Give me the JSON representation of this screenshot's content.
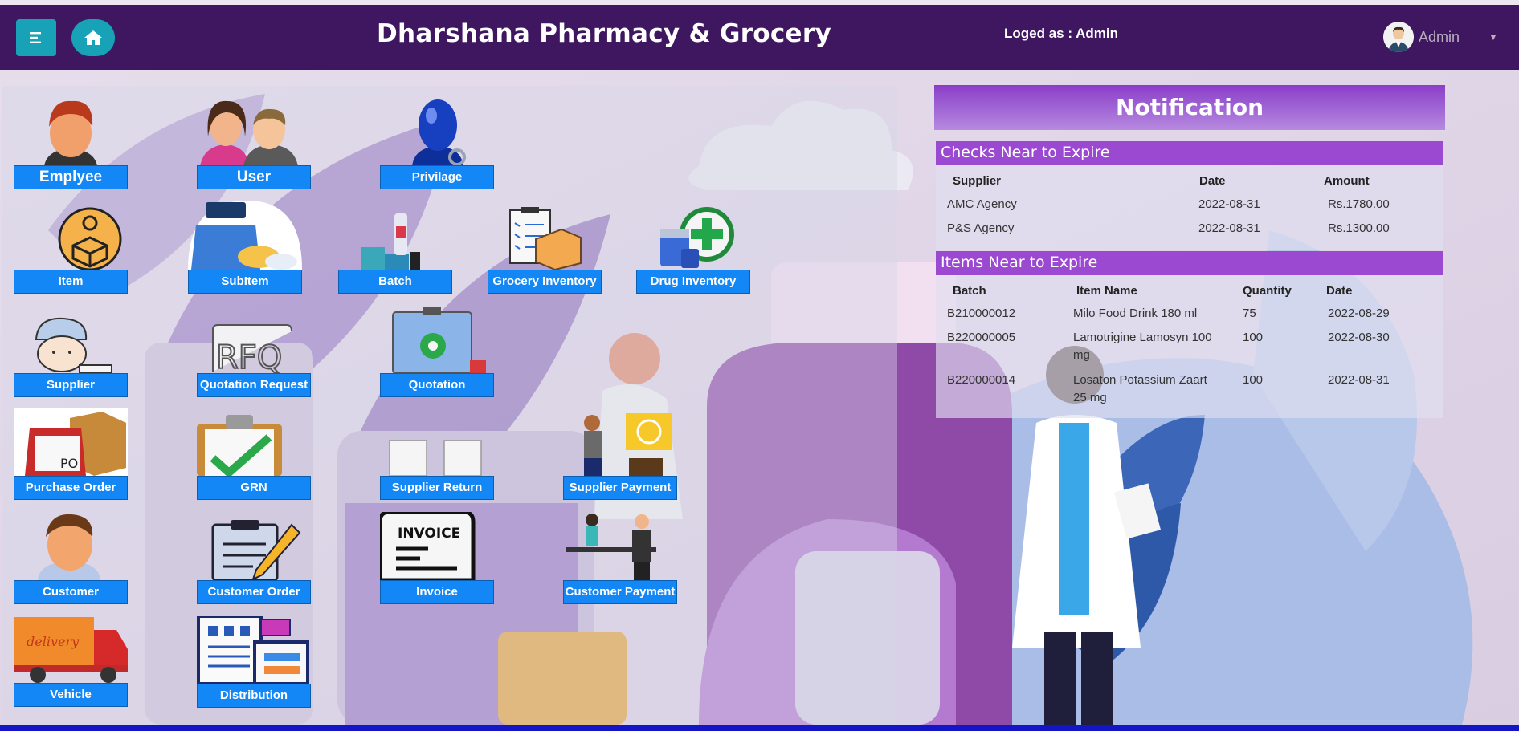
{
  "header": {
    "title": "Dharshana Pharmacy & Grocery",
    "logged_as": "Loged as : Admin",
    "user_name": "Admin",
    "color": "#3e1760",
    "button_color": "#17a2b8"
  },
  "tiles": {
    "employee": "Emplyee",
    "user": "User",
    "privilege": "Privilage",
    "item": "Item",
    "subitem": "SubItem",
    "batch": "Batch",
    "grocery_inventory": "Grocery Inventory",
    "drug_inventory": "Drug Inventory",
    "supplier": "Supplier",
    "quotation_request": "Quotation Request",
    "quotation": "Quotation",
    "purchase_order": "Purchase Order",
    "grn": "GRN",
    "supplier_return": "Supplier Return",
    "supplier_payment": "Supplier Payment",
    "customer": "Customer",
    "customer_order": "Customer Order",
    "invoice": "Invoice",
    "customer_payment": "Customer Payment",
    "vehicle": "Vehicle",
    "distribution": "Distribution"
  },
  "tile_color": "#1287f5",
  "icon_text": {
    "rfq": "RFQ",
    "po": "PO",
    "invoice": "INVOICE",
    "delivery": "delivery"
  },
  "notification": {
    "title": "Notification",
    "checks": {
      "heading": "Checks Near to Expire",
      "columns": [
        "Supplier",
        "Date",
        "Amount"
      ],
      "rows": [
        [
          "AMC Agency",
          "2022-08-31",
          "Rs.1780.00"
        ],
        [
          "P&S Agency",
          "2022-08-31",
          "Rs.1300.00"
        ]
      ]
    },
    "items": {
      "heading": "Items Near to Expire",
      "columns": [
        "Batch",
        "Item Name",
        "Quantity",
        "Date"
      ],
      "rows": [
        [
          "B210000012",
          "Milo Food Drink 180 ml",
          "75",
          "2022-08-29"
        ],
        [
          "B220000005",
          "Lamotrigine Lamosyn 100 mg",
          "100",
          "2022-08-30"
        ],
        [
          "B220000014",
          "Losaton Potassium Zaart 25 mg",
          "100",
          "2022-08-31"
        ]
      ]
    },
    "accent": "#9c49d2"
  }
}
